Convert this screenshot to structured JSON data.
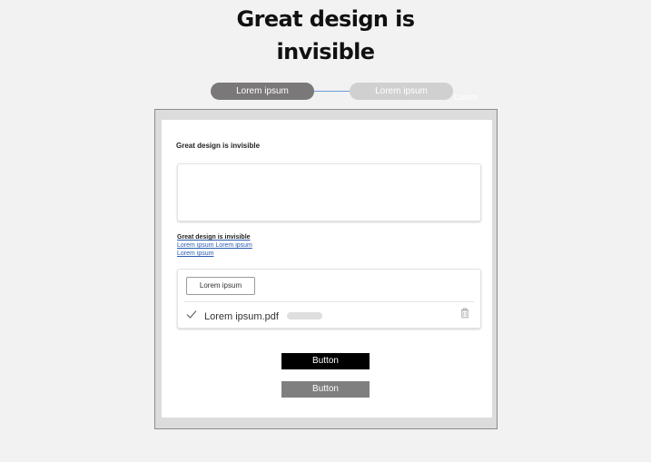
{
  "hero": {
    "title_line1": "Great design is",
    "title_line2": "invisible"
  },
  "stepper": {
    "step1": "Lorem ipsum",
    "step2": "Lorem ipsum",
    "ghost": "Lorem"
  },
  "form": {
    "title": "Great design is invisible",
    "textarea_value": "",
    "links": {
      "title": "Great design is invisible",
      "link1": "Lorem ipsum Lorem ipsum",
      "link2": "Lorem ipsum"
    },
    "upload": {
      "button_label": "Lorem ipsum",
      "file_name": "Lorem ipsum.pdf",
      "file_status_icon": "check-icon",
      "delete_icon": "trash-icon"
    },
    "buttons": {
      "primary": "Button",
      "secondary": "Button"
    }
  },
  "colors": {
    "background": "#f2f2f2",
    "step_active": "#7a7879",
    "step_inactive": "#d0d0d0",
    "link": "#2a5db0",
    "primary_button": "#000000",
    "secondary_button": "#7f7f7f"
  }
}
